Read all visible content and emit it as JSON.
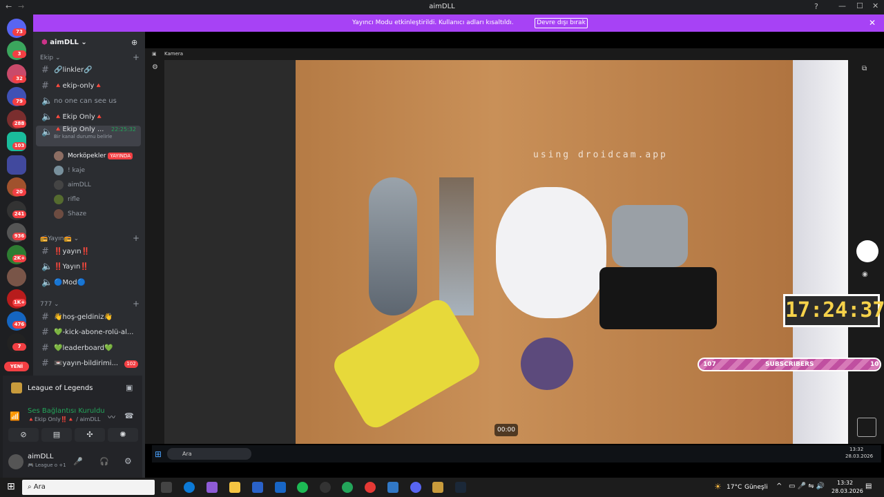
{
  "window": {
    "title": "aimDLL"
  },
  "banner": {
    "message": "Yayıncı Modu etkinleştirildi. Kullanıcı adları kısaltıldı.",
    "button": "Devre dışı bırak"
  },
  "server": {
    "name": "aimDLL"
  },
  "badges": [
    "73",
    "3",
    "32",
    "79",
    "288",
    "103",
    "20",
    "241",
    "936",
    "2K+",
    "1K+",
    "476",
    "7"
  ],
  "new_label": "YENİ",
  "categories": {
    "ekip": "Ekip",
    "yayin": "📻Yayın📻",
    "777": "777"
  },
  "channels": {
    "linkler": "🔗linkler🔗",
    "ekip_only": "🔺ekip-only🔺",
    "no_one": "no one can see us",
    "ekip_only_v": "🔺Ekip Only🔺",
    "ekip_only_active": "🔺Ekip Only ...",
    "active_time": "22:25:32",
    "status_hint": "Bir kanal durumu belirle",
    "yayin1": "‼️yayın‼️",
    "yayin2": "‼️Yayın‼️",
    "mod": "🔵Mod🔵",
    "hos": "👋hoş-geldiniz👋",
    "kick": "💚-kick-abone-rolü-al...",
    "leaderboard": "💚leaderboard💚",
    "yayin_bildirim": "📼yayın-bildirimi...",
    "yayin_bildirim_badge": "102"
  },
  "voice_users": [
    {
      "name": "Morköpekler",
      "tag": "YAYINDA"
    },
    {
      "name": "! kaje"
    },
    {
      "name": "aimDLL"
    },
    {
      "name": "rifle"
    },
    {
      "name": "Shaze"
    }
  ],
  "activity": {
    "game": "League of Legends"
  },
  "voice_status": {
    "title": "Ses Bağlantısı Kuruldu",
    "channel": "🔺Ekip Only‼️🔺 / aimDLL"
  },
  "user_panel": {
    "name": "aimDLL",
    "status": "🎮 League o +1"
  },
  "camera": {
    "title": "Kamera",
    "watermark": "using droidcam.app",
    "timer": "00:00"
  },
  "overlay": {
    "clock": "17:24:37",
    "subs_left": "107",
    "subs_label": "SUBSCRIBERS",
    "subs_right": "10"
  },
  "inner_taskbar": {
    "search": "Ara",
    "time": "13:32",
    "date": "28.03.2026"
  },
  "taskbar": {
    "search": "Ara",
    "weather": "17°C",
    "weather_label": "Güneşli",
    "time": "13:32",
    "date": "28.03.2026"
  },
  "colors": {
    "accent": "#a742f5",
    "badge": "#f23f43",
    "live": "#f23f43",
    "connected": "#23a55a"
  }
}
